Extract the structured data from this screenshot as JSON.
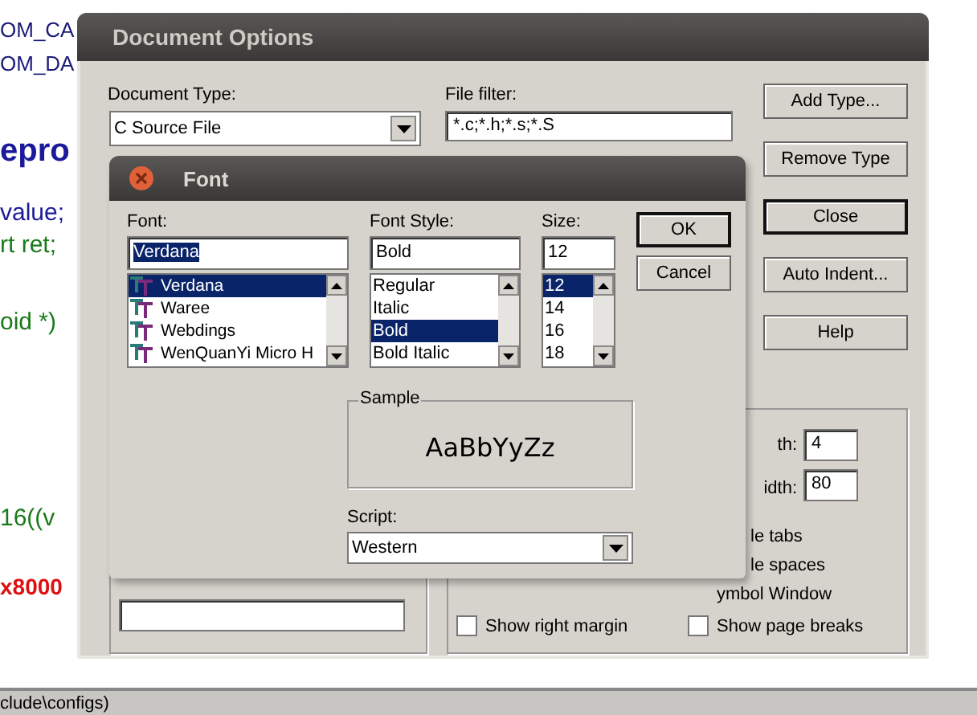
{
  "editor": {
    "lines": [
      {
        "text": "OM_CA",
        "color": "#1a1a7a"
      },
      {
        "text": "OM_DA",
        "color": "#1a1a7a"
      },
      {
        "text": "epro",
        "color": "#1a1a9a",
        "kind": "heading"
      },
      {
        "text": "value;",
        "color": "#1a1a9a"
      },
      {
        "text": "rt ret;",
        "color": "#1a7a1a"
      },
      {
        "text": "oid *)",
        "color": "#1a7a1a"
      },
      {
        "text": "16((v",
        "color": "#1a7a1a"
      },
      {
        "text": "x8000",
        "color": "#dd1111"
      }
    ],
    "status_bar": "clude\\configs)"
  },
  "document_options": {
    "title": "Document Options",
    "document_type_label": "Document Type:",
    "document_type": "C Source File",
    "file_filter_label": "File filter:",
    "file_filter": "*.c;*.h;*.s;*.S",
    "buttons": [
      {
        "label": "Add Type...",
        "default": false
      },
      {
        "label": "Remove Type",
        "default": false
      },
      {
        "label": "Close",
        "default": true
      },
      {
        "label": "Auto Indent...",
        "default": false
      },
      {
        "label": "Help",
        "default": false
      }
    ],
    "fields": [
      {
        "label": "th:",
        "value": "4"
      },
      {
        "label": "idth:",
        "value": "80"
      }
    ],
    "options": [
      {
        "label": "le tabs",
        "kind": "text"
      },
      {
        "label": "le spaces",
        "kind": "text"
      },
      {
        "label": "ymbol Window",
        "kind": "text"
      },
      {
        "label": "Show right margin",
        "kind": "checkbox",
        "checked": false
      },
      {
        "label": "Show page breaks",
        "kind": "checkbox",
        "checked": false
      }
    ]
  },
  "font_dialog": {
    "title": "Font",
    "font_label": "Font:",
    "font_value": "Verdana",
    "fonts": [
      {
        "name": "Verdana",
        "selected": true
      },
      {
        "name": "Waree",
        "selected": false
      },
      {
        "name": "Webdings",
        "selected": false
      },
      {
        "name": "WenQuanYi Micro H",
        "selected": false
      }
    ],
    "style_label": "Font Style:",
    "style_value": "Bold",
    "styles": [
      {
        "name": "Regular",
        "selected": false
      },
      {
        "name": "Italic",
        "selected": false
      },
      {
        "name": "Bold",
        "selected": true
      },
      {
        "name": "Bold Italic",
        "selected": false
      }
    ],
    "size_label": "Size:",
    "size_value": "12",
    "sizes": [
      {
        "name": "12",
        "selected": true
      },
      {
        "name": "14",
        "selected": false
      },
      {
        "name": "16",
        "selected": false
      },
      {
        "name": "18",
        "selected": false
      }
    ],
    "buttons": [
      "OK",
      "Cancel"
    ],
    "sample_label": "Sample",
    "sample_text": "AaBbYyZz",
    "script_label": "Script:",
    "script_value": "Western"
  }
}
